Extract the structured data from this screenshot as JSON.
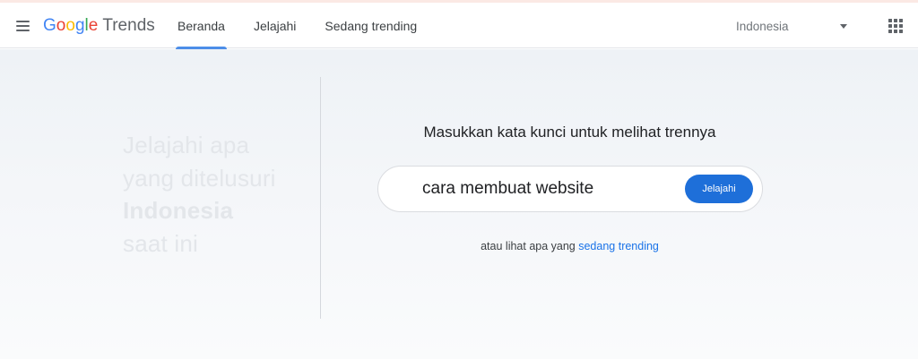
{
  "header": {
    "logo": {
      "google_letters": [
        {
          "ch": "G",
          "color": "#4285F4"
        },
        {
          "ch": "o",
          "color": "#EA4335"
        },
        {
          "ch": "o",
          "color": "#FBBC05"
        },
        {
          "ch": "g",
          "color": "#4285F4"
        },
        {
          "ch": "l",
          "color": "#34A853"
        },
        {
          "ch": "e",
          "color": "#EA4335"
        }
      ],
      "product": "Trends"
    },
    "tabs": [
      {
        "label": "Beranda",
        "active": true
      },
      {
        "label": "Jelajahi",
        "active": false
      },
      {
        "label": "Sedang trending",
        "active": false
      }
    ],
    "country": "Indonesia",
    "icons": {
      "menu": "hamburger-menu-icon",
      "apps": "apps-grid-icon",
      "dropdown": "caret-down-icon"
    }
  },
  "hero": {
    "tagline": [
      "Jelajahi apa",
      "yang ditelusuri",
      "Indonesia",
      "saat ini"
    ],
    "prompt": "Masukkan kata kunci untuk melihat trennya",
    "search": {
      "value": "cara membuat website",
      "button_label": "Jelajahi"
    },
    "hint_prefix": "atau lihat apa yang",
    "hint_link": "sedang trending"
  },
  "colors": {
    "accent": "#1e6fd9",
    "link": "#1a73e8",
    "active_tab_indicator": "#4d8ee8"
  }
}
